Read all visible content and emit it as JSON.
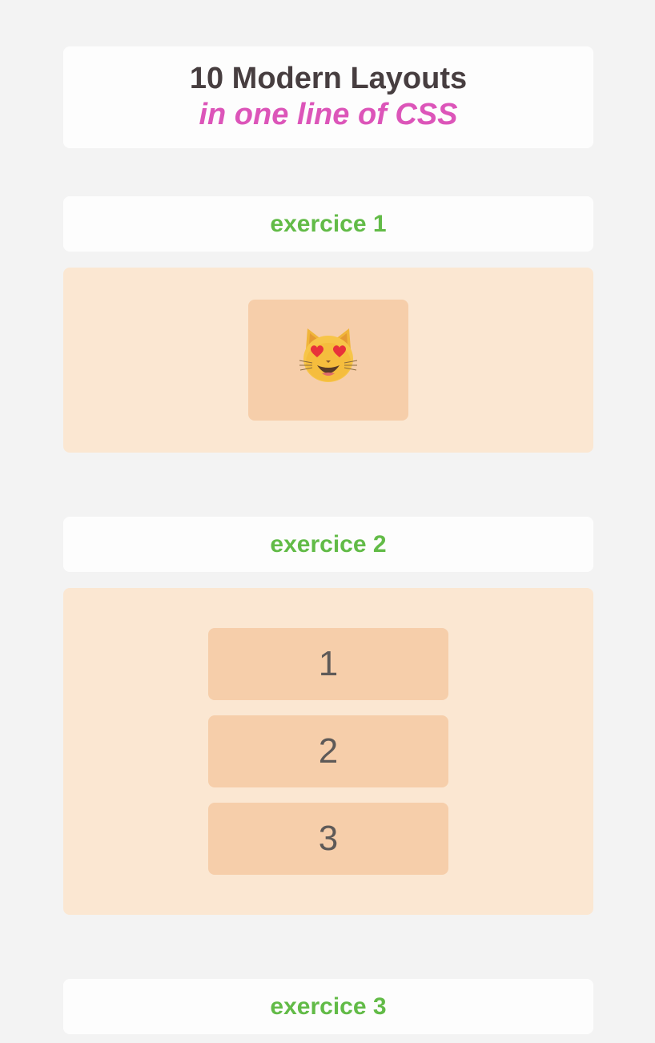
{
  "header": {
    "title": "10 Modern Layouts",
    "subtitle": "in one line of CSS"
  },
  "exercises": [
    {
      "label": "exercice 1",
      "emoji": "smiling-cat-heart-eyes"
    },
    {
      "label": "exercice 2",
      "items": [
        "1",
        "2",
        "3"
      ]
    },
    {
      "label": "exercice 3"
    }
  ],
  "colors": {
    "background": "#f3f3f3",
    "card": "#fdfdfd",
    "title": "#473e40",
    "subtitle": "#dc55b9",
    "exercise_label": "#62bb47",
    "demo_bg": "#fbe7d2",
    "box_bg": "#f6ceaa"
  }
}
